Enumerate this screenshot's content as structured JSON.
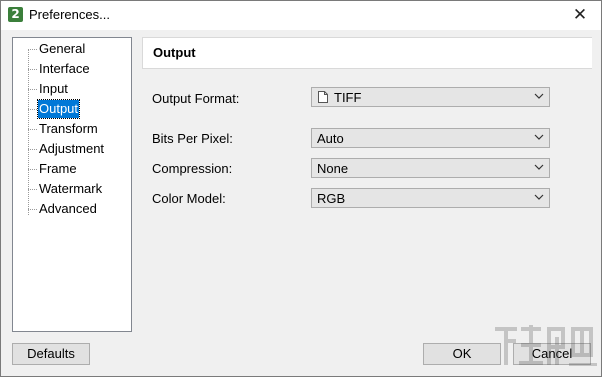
{
  "window": {
    "title": "Preferences...",
    "app_icon_glyph": "2",
    "app_icon_color": "#3b7f3b",
    "close_glyph": "✕"
  },
  "sidebar": {
    "items": [
      {
        "label": "General",
        "selected": false
      },
      {
        "label": "Interface",
        "selected": false
      },
      {
        "label": "Input",
        "selected": false
      },
      {
        "label": "Output",
        "selected": true
      },
      {
        "label": "Transform",
        "selected": false
      },
      {
        "label": "Adjustment",
        "selected": false
      },
      {
        "label": "Frame",
        "selected": false
      },
      {
        "label": "Watermark",
        "selected": false
      },
      {
        "label": "Advanced",
        "selected": false
      }
    ],
    "selected_color": "#0078d7"
  },
  "panel": {
    "title": "Output",
    "fields": {
      "output_format": {
        "label": "Output Format:",
        "value": "TIFF",
        "icon": "file-icon"
      },
      "bits_per_pixel": {
        "label": "Bits Per Pixel:",
        "value": "Auto"
      },
      "compression": {
        "label": "Compression:",
        "value": "None"
      },
      "color_model": {
        "label": "Color Model:",
        "value": "RGB"
      }
    }
  },
  "buttons": {
    "defaults": "Defaults",
    "ok": "OK",
    "cancel": "Cancel"
  }
}
